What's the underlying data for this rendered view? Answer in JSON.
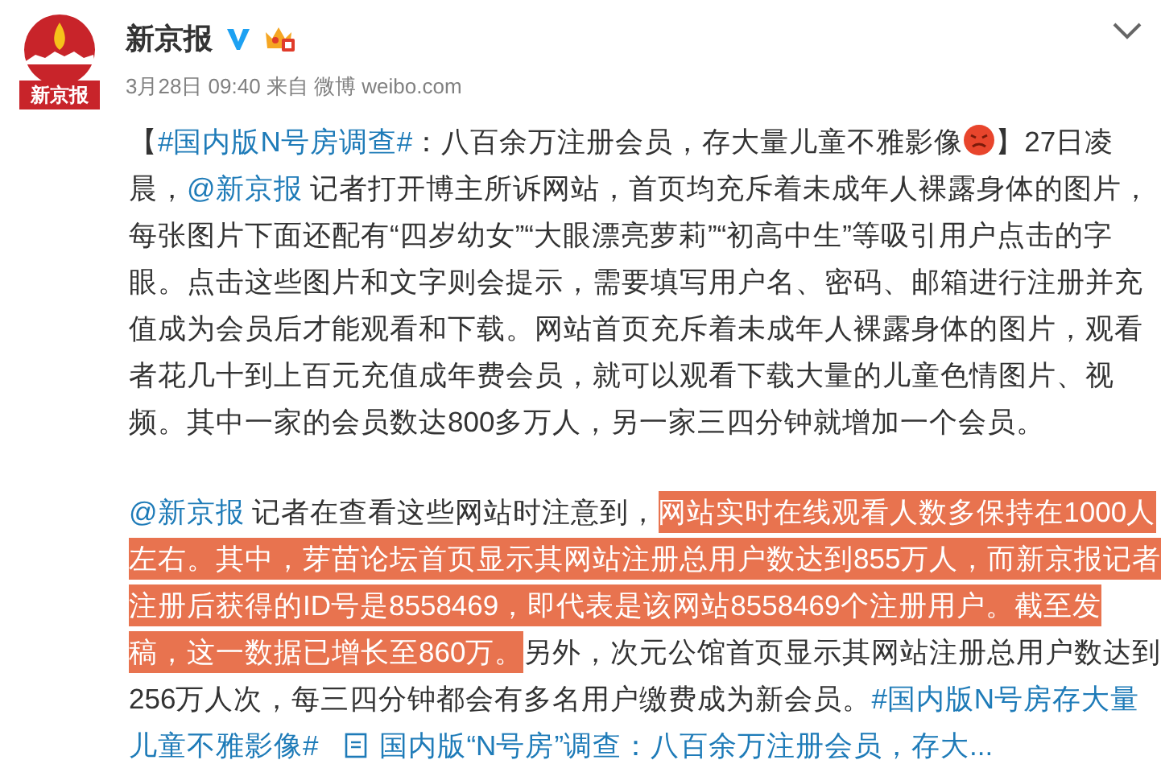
{
  "author": {
    "name": "新京报",
    "logo_text": "新京报",
    "verified": true,
    "time": "3月28日 09:40",
    "source_prefix": "来自",
    "source": "微博 weibo.com"
  },
  "paragraphs": [
    {
      "lines": [
        [
          {
            "kind": "text",
            "text": "【"
          },
          {
            "kind": "hashtag",
            "text": "#国内版N号房调查#"
          },
          {
            "kind": "text",
            "text": "：八百余万注册会员，存大量儿童不雅影像"
          },
          {
            "kind": "emoji"
          },
          {
            "kind": "text",
            "text": "】27日凌"
          }
        ],
        [
          {
            "kind": "text",
            "text": "晨，"
          },
          {
            "kind": "mention",
            "text": "@新京报"
          },
          {
            "kind": "text",
            "text": " 记者打开博主所诉网站，首页均充斥着未成年人裸露身体的图片，"
          }
        ],
        [
          {
            "kind": "text",
            "text": "每张图片下面还配有“四岁幼女”“大眼漂亮萝莉”“初高中生”等吸引用户点击的字"
          }
        ],
        [
          {
            "kind": "text",
            "text": "眼。点击这些图片和文字则会提示，需要填写用户名、密码、邮箱进行注册并充"
          }
        ],
        [
          {
            "kind": "text",
            "text": "值成为会员后才能观看和下载。网站首页充斥着未成年人裸露身体的图片，观看"
          }
        ],
        [
          {
            "kind": "text",
            "text": "者花几十到上百元充值成年费会员，就可以观看下载大量的儿童色情图片、视"
          }
        ],
        [
          {
            "kind": "text",
            "text": "频。其中一家的会员数达800多万人，另一家三四分钟就增加一个会员。"
          }
        ]
      ]
    },
    {
      "lines": [
        [
          {
            "kind": "mention",
            "text": "@新京报"
          },
          {
            "kind": "text",
            "text": " 记者在查看这些网站时注意到，"
          },
          {
            "kind": "highlight",
            "text": "网站实时在线观看人数多保持在1000人"
          }
        ],
        [
          {
            "kind": "highlight",
            "text": "左右。其中，芽苗论坛首页显示其网站注册总用户数达到855万人，而新京报记者"
          }
        ],
        [
          {
            "kind": "highlight",
            "text": "注册后获得的ID号是8558469，即代表是该网站8558469个注册用户。截至发"
          }
        ],
        [
          {
            "kind": "highlight",
            "text": "稿，这一数据已增长至860万。"
          },
          {
            "kind": "text",
            "text": "另外，次元公馆首页显示其网站注册总用户数达到"
          }
        ],
        [
          {
            "kind": "text",
            "text": "256万人次，每三四分钟都会有多名用户缴费成为新会员。"
          },
          {
            "kind": "hashtag",
            "text": "#国内版N号房存大量"
          }
        ],
        [
          {
            "kind": "hashtag",
            "text": "儿童不雅影像#"
          },
          {
            "kind": "article",
            "text": "国内版“N号房”调查：八百余万注册会员，存大..."
          }
        ]
      ]
    }
  ]
}
